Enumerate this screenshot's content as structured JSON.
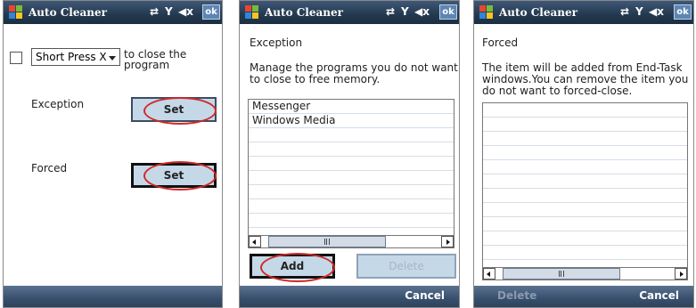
{
  "colors": {
    "titlebar": "#24394f",
    "button_fill": "#c5d8e8",
    "annotation": "#d02a2a",
    "softbar": "#38506d"
  },
  "screens": [
    {
      "title": "Auto Cleaner",
      "ok": "ok",
      "press_option": "Short Press X",
      "close_text": [
        "to close the",
        "program"
      ],
      "exception_label": "Exception",
      "exception_button": "Set",
      "forced_label": "Forced",
      "forced_button": "Set"
    },
    {
      "title": "Auto Cleaner",
      "ok": "ok",
      "heading": "Exception",
      "description": [
        "Manage the programs you do not want",
        "to close to free memory."
      ],
      "items": [
        "Messenger",
        "Windows Media"
      ],
      "add_button": "Add",
      "delete_button": "Delete",
      "softkey_right": "Cancel"
    },
    {
      "title": "Auto Cleaner",
      "ok": "ok",
      "heading": "Forced",
      "description": [
        "The item will be added from End-Task",
        "windows.You can remove the item you",
        "do not want to forced-close."
      ],
      "softkey_left": "Delete",
      "softkey_right": "Cancel"
    }
  ],
  "icons": [
    "windows-logo-icon",
    "connectivity-icon",
    "signal-icon",
    "volume-mute-icon",
    "scroll-left-icon",
    "scroll-right-icon",
    "dropdown-arrow-icon"
  ]
}
